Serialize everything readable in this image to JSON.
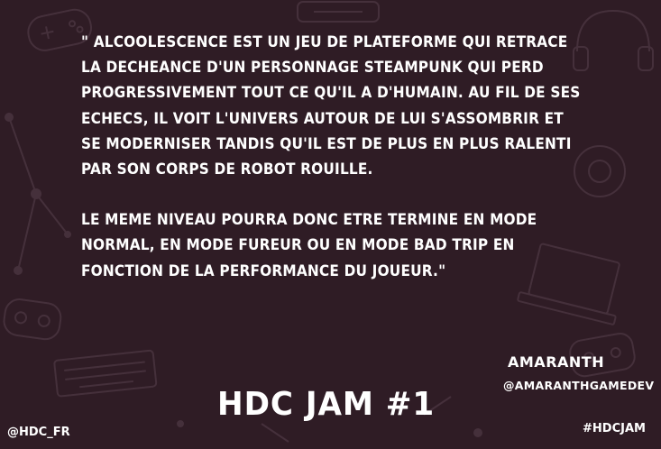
{
  "quote": {
    "paragraph1": "\" ALCOOLESCENCE EST UN JEU DE PLATEFORME QUI RETRACE LA DECHEANCE D'UN PERSONNAGE STEAMPUNK QUI PERD PROGRESSIVEMENT TOUT CE QU'IL A D'HUMAIN. AU FIL DE SES ECHECS, IL VOIT L'UNIVERS AUTOUR DE LUI S'ASSOMBRIR ET SE MODERNISER TANDIS QU'IL EST DE PLUS EN PLUS RALENTI PAR SON CORPS DE ROBOT ROUILLE.",
    "paragraph2": "LE MEME NIVEAU POURRA DONC ETRE TERMINE EN MODE NORMAL, EN MODE FUREUR OU EN MODE BAD TRIP EN FONCTION DE LA PERFORMANCE DU JOUEUR.\""
  },
  "author": {
    "name": "AMARANTH",
    "handle": "@AMARANTHGAMEDEV"
  },
  "jam_title": "HDC JAM #1",
  "footer": {
    "handle": "@HDC_FR",
    "hashtag": "#HDCJAM"
  },
  "colors": {
    "background": "#2f1c25",
    "text": "#ffffff",
    "decor": "#4a3540"
  },
  "background_icons": [
    "gamepad-icon",
    "laptop-icon",
    "headphones-icon",
    "controller-icon",
    "keyboard-icon",
    "console-icon",
    "network-nodes-icon"
  ]
}
